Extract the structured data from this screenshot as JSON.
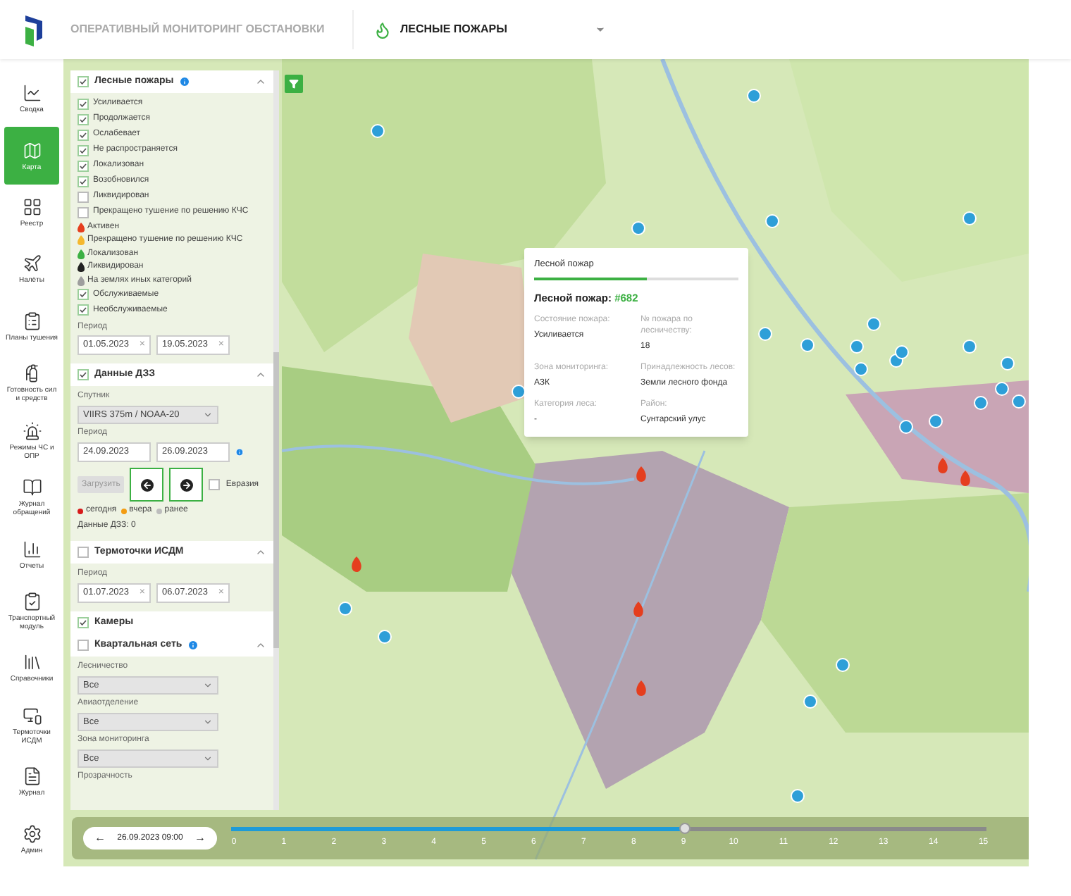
{
  "header": {
    "title": "ОПЕРАТИВНЫЙ МОНИТОРИНГ ОБСТАНОВКИ",
    "layer": "ЛЕСНЫЕ ПОЖАРЫ"
  },
  "nav": [
    {
      "label": "Сводка",
      "selected": false
    },
    {
      "label": "Карта",
      "selected": true
    },
    {
      "label": "Реестр",
      "selected": false
    },
    {
      "label": "Налёты",
      "selected": false
    },
    {
      "label": "Планы тушения",
      "selected": false
    },
    {
      "label": "Готовность сил и средств",
      "selected": false
    },
    {
      "label": "Режимы ЧС и ОПР",
      "selected": false
    },
    {
      "label": "Журнал обращений",
      "selected": false
    },
    {
      "label": "Отчеты",
      "selected": false
    },
    {
      "label": "Транспортный модуль",
      "selected": false
    },
    {
      "label": "Справочники",
      "selected": false
    },
    {
      "label": "Термоточки ИСДМ",
      "selected": false
    },
    {
      "label": "Журнал",
      "selected": false
    },
    {
      "label": "Админ",
      "selected": false
    }
  ],
  "fires": {
    "title": "Лесные пожары",
    "checked": true,
    "statuses": [
      {
        "label": "Усиливается",
        "checked": true
      },
      {
        "label": "Продолжается",
        "checked": true
      },
      {
        "label": "Ослабевает",
        "checked": true
      },
      {
        "label": "Не распространяется",
        "checked": true
      },
      {
        "label": "Локализован",
        "checked": true
      },
      {
        "label": "Возобновился",
        "checked": true
      },
      {
        "label": "Ликвидирован",
        "checked": false
      },
      {
        "label": "Прекращено тушение по решению КЧС",
        "checked": false
      }
    ],
    "legend": [
      {
        "label": "Активен",
        "color": "#e53e1e"
      },
      {
        "label": "Прекращено тушение по решению КЧС",
        "color": "#f5b82e"
      },
      {
        "label": "Локализован",
        "color": "#3cb043"
      },
      {
        "label": "Ликвидирован",
        "color": "#222222"
      },
      {
        "label": "На землях иных категорий",
        "color": "#9e9e9e"
      }
    ],
    "service": [
      {
        "label": "Обслуживаемые",
        "checked": true
      },
      {
        "label": "Необслуживаемые",
        "checked": true
      }
    ],
    "period_label": "Период",
    "from": "01.05.2023",
    "to": "19.05.2023",
    "clear": "×"
  },
  "dzz": {
    "title": "Данные ДЗЗ",
    "checked": true,
    "satellite_label": "Спутник",
    "satellite": "VIIRS 375m / NOAA-20",
    "period_label": "Период",
    "from": "24.09.2023",
    "to": "26.09.2023",
    "load": "Загрузить",
    "eurasia": {
      "label": "Евразия",
      "checked": false
    },
    "legend": [
      {
        "label": "сегодня",
        "color": "#d71a1a"
      },
      {
        "label": "вчера",
        "color": "#f39c12"
      },
      {
        "label": "ранее",
        "color": "#bdbdbd"
      }
    ],
    "count": "Данные ДЗЗ: 0"
  },
  "thermal": {
    "title": "Термоточки ИСДМ",
    "checked": false,
    "period_label": "Период",
    "from": "01.07.2023",
    "to": "06.07.2023",
    "clear": "×"
  },
  "cameras": {
    "title": "Камеры",
    "checked": true
  },
  "kvartal": {
    "title": "Квартальная сеть",
    "checked": false,
    "fields": [
      {
        "label": "Лесничество",
        "value": "Все"
      },
      {
        "label": "Авиаотделение",
        "value": "Все"
      },
      {
        "label": "Зона мониторинга",
        "value": "Все"
      }
    ],
    "transparency_label": "Прозрачность"
  },
  "popup": {
    "tab": "Лесной пожар",
    "title": "Лесной пожар:",
    "number": "#682",
    "fields": [
      {
        "label": "Состояние пожара:",
        "value": "Усиливается"
      },
      {
        "label": "№ пожара по лесничеству:",
        "value": "18"
      },
      {
        "label": "Зона мониторинга:",
        "value": "АЗК"
      },
      {
        "label": "Принадлежность лесов:",
        "value": "Земли лесного фонда"
      },
      {
        "label": "Категория леса:",
        "value": "-"
      },
      {
        "label": "Район:",
        "value": "Сунтарский улус"
      }
    ]
  },
  "timeline": {
    "prev": "←",
    "datetime": "26.09.2023 09:00",
    "next": "→",
    "level": 0.6,
    "ticks": [
      "0",
      "1",
      "2",
      "3",
      "4",
      "5",
      "6",
      "7",
      "8",
      "9",
      "10",
      "11",
      "12",
      "13",
      "14",
      "15"
    ]
  }
}
